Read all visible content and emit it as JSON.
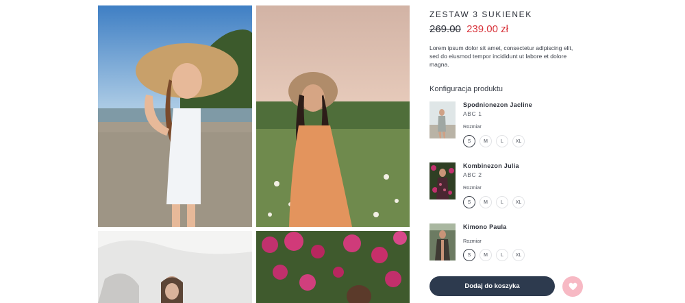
{
  "product": {
    "title": "ZESTAW 3 SUKIENEK",
    "old_price": "269.00",
    "new_price": "239.00 zł",
    "description": "Lorem ipsum dolor sit amet, consectetur adipiscing elit, sed do eiusmod tempor incididunt ut labore et dolore magna."
  },
  "configuration": {
    "heading": "Konfiguracja produktu",
    "items": [
      {
        "name": "Spodnionezon Jacline",
        "code": "ABC 1",
        "size_label": "Rozmiar",
        "sizes": [
          "S",
          "M",
          "L",
          "XL"
        ],
        "selected_size": "S"
      },
      {
        "name": "Kombinezon Julia",
        "code": "ABC 2",
        "size_label": "Rozmiar",
        "sizes": [
          "S",
          "M",
          "L",
          "XL"
        ],
        "selected_size": "S"
      },
      {
        "name": "Kimono Paula",
        "code": "",
        "size_label": "Rozmiar",
        "sizes": [
          "S",
          "M",
          "L",
          "XL"
        ],
        "selected_size": "S"
      }
    ]
  },
  "actions": {
    "add_to_cart_label": "Dodaj do koszyka",
    "wishlist_icon": "heart-icon"
  },
  "colors": {
    "sale_price": "#d8323a",
    "primary_button": "#2d3a4e",
    "wishlist_button": "#f7b9c4"
  }
}
